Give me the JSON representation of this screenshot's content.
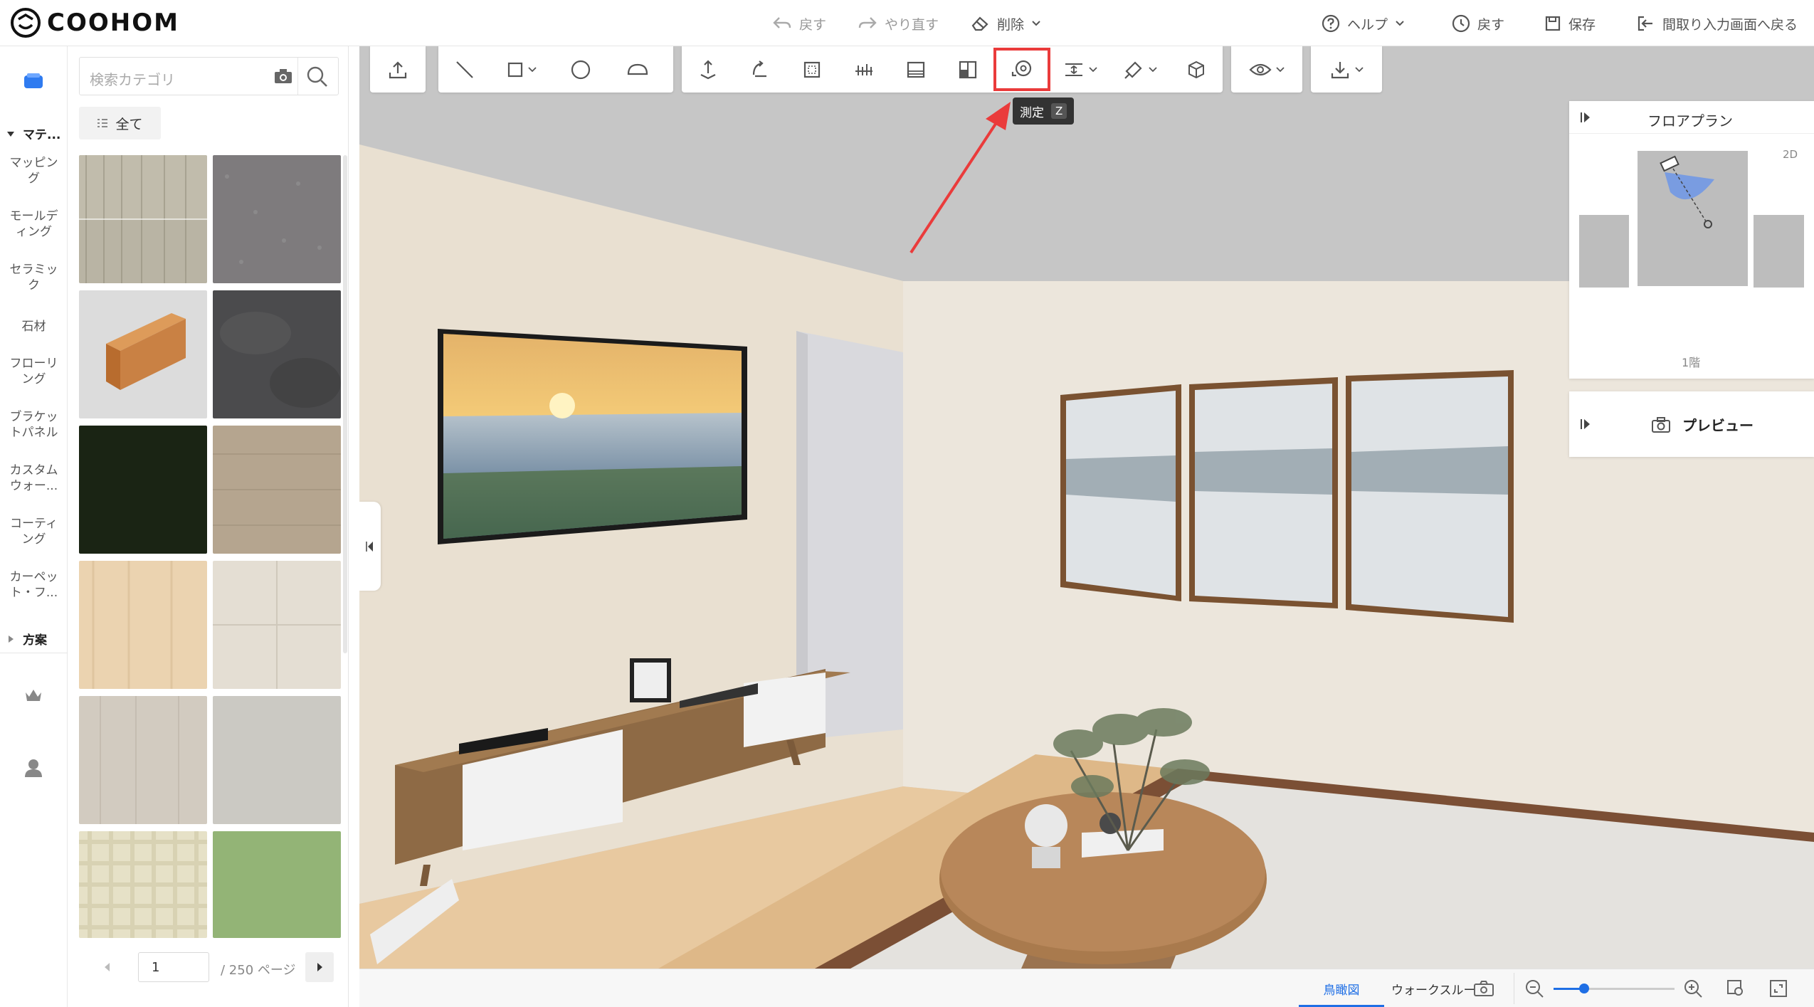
{
  "brand": {
    "name": "COOHOM"
  },
  "topbar": {
    "undo_label": "戻す",
    "redo_label": "やり直す",
    "delete_label": "削除",
    "help_label": "ヘルプ",
    "history_label": "戻す",
    "save_label": "保存",
    "back_to_floorplan_label": "間取り入力画面へ戻る"
  },
  "leftrail": {
    "materials_section": "マテ...",
    "items": [
      "マッピング",
      "モールディング",
      "セラミック",
      "石材",
      "フローリング",
      "ブラケットパネル",
      "カスタムウォー...",
      "コーティング",
      "カーペット・フ..."
    ],
    "plans_section": "方案"
  },
  "materials": {
    "search_placeholder": "検索カテゴリ",
    "all_label": "全て",
    "swatch_colors": [
      "#b9b4a4",
      "#7e7b7d",
      "#dcdcdc",
      "#4b4b4d",
      "#1a2414",
      "#b5a58f",
      "#ebd3b0",
      "#e4ded3",
      "#d2cbc0",
      "#cbc9c3",
      "#e6e1c7",
      "#93b476"
    ],
    "pager": {
      "current_page": "1",
      "total_label": "/ 250 ページ"
    }
  },
  "toolbar": {
    "measure_tooltip": "測定",
    "measure_shortcut": "Z",
    "highlight_color": "#ea3b3b"
  },
  "floorplan": {
    "title": "フロアプラン",
    "view_toggle": "2D",
    "floor_label": "1階"
  },
  "preview": {
    "title": "プレビュー"
  },
  "bottombar": {
    "tabs": [
      "鳥瞰図",
      "ウォークスルー"
    ],
    "active_tab": "鳥瞰図",
    "zoom_level": 0.25,
    "accent": "#1f6fe5"
  }
}
